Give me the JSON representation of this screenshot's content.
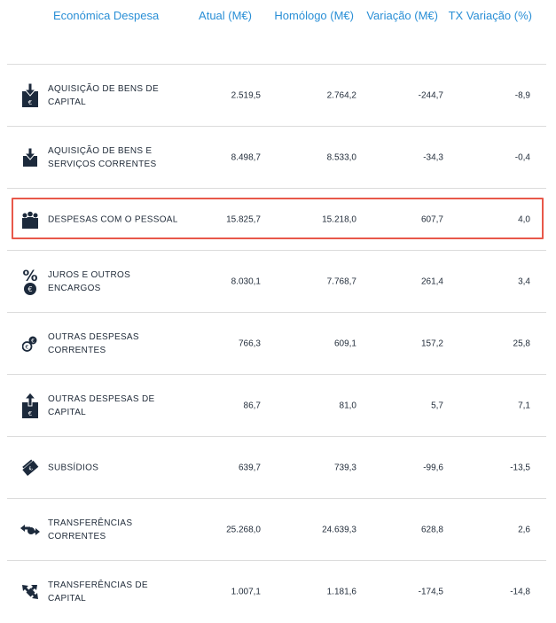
{
  "header": {
    "col0": "Económica Despesa",
    "col1": "Atual (M€)",
    "col2": "Homólogo (M€)",
    "col3": "Variação (M€)",
    "col4": "TX Variação (%)"
  },
  "rows": [
    {
      "label": "AQUISIÇÃO DE BENS DE CAPITAL",
      "atual": "2.519,5",
      "homologo": "2.764,2",
      "variacao": "-244,7",
      "tx": "-8,9",
      "icon": "capital-goods-icon"
    },
    {
      "label": "AQUISIÇÃO DE BENS E SERVIÇOS CORRENTES",
      "atual": "8.498,7",
      "homologo": "8.533,0",
      "variacao": "-34,3",
      "tx": "-0,4",
      "icon": "goods-services-icon"
    },
    {
      "label": "DESPESAS COM O PESSOAL",
      "atual": "15.825,7",
      "homologo": "15.218,0",
      "variacao": "607,7",
      "tx": "4,0",
      "icon": "people-icon"
    },
    {
      "label": "JUROS E OUTROS ENCARGOS",
      "atual": "8.030,1",
      "homologo": "7.768,7",
      "variacao": "261,4",
      "tx": "3,4",
      "icon": "percent-euro-icon"
    },
    {
      "label": "OUTRAS DESPESAS CORRENTES",
      "atual": "766,3",
      "homologo": "609,1",
      "variacao": "157,2",
      "tx": "25,8",
      "icon": "coins-icon"
    },
    {
      "label": "OUTRAS DESPESAS DE CAPITAL",
      "atual": "86,7",
      "homologo": "81,0",
      "variacao": "5,7",
      "tx": "7,1",
      "icon": "capital-up-icon"
    },
    {
      "label": "SUBSÍDIOS",
      "atual": "639,7",
      "homologo": "739,3",
      "variacao": "-99,6",
      "tx": "-13,5",
      "icon": "subsidy-icon"
    },
    {
      "label": "TRANSFERÊNCIAS CORRENTES",
      "atual": "25.268,0",
      "homologo": "24.639,3",
      "variacao": "628,8",
      "tx": "2,6",
      "icon": "transfer-current-icon"
    },
    {
      "label": "TRANSFERÊNCIAS DE CAPITAL",
      "atual": "1.007,1",
      "homologo": "1.181,6",
      "variacao": "-174,5",
      "tx": "-14,8",
      "icon": "transfer-capital-icon"
    }
  ],
  "highlight_row": 2,
  "colors": {
    "header_text": "#2a8fd6",
    "icon": "#1c2a3c",
    "highlight": "#e8584a",
    "rule": "#dcdcdc"
  }
}
